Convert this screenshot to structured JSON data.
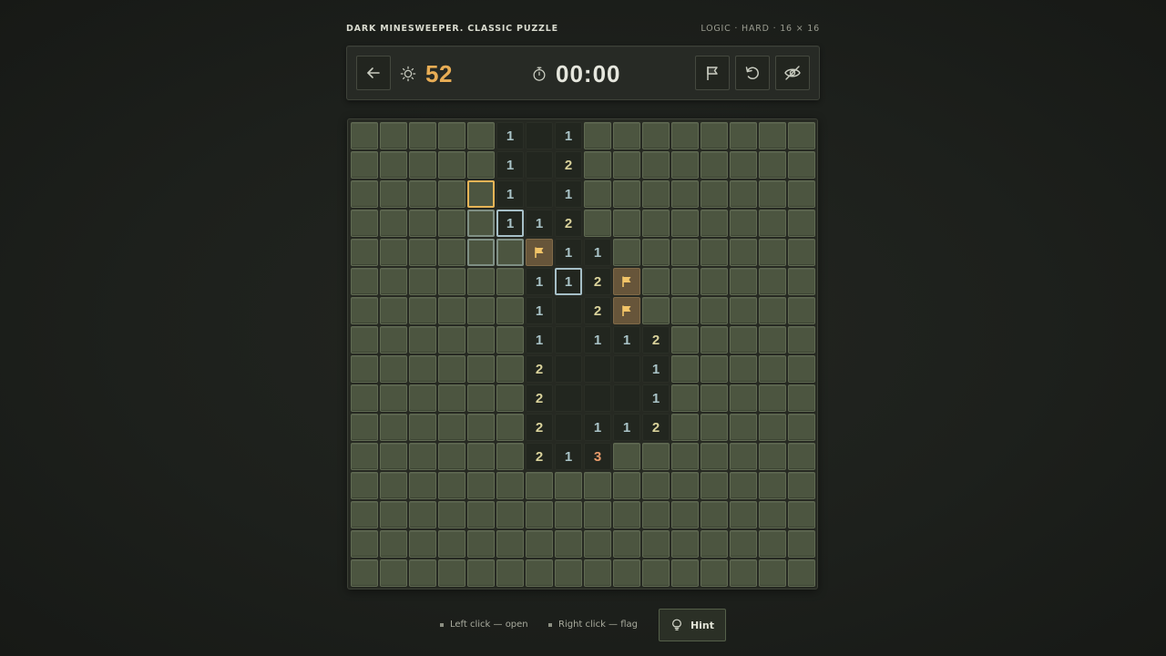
{
  "header": {
    "title": "DARK MINESWEEPER. CLASSIC PUZZLE",
    "meta": "LOGIC · HARD · 16 × 16"
  },
  "toolbar": {
    "back_icon": "arrow-left-icon",
    "mine_counter": {
      "icon": "sun-icon",
      "value": "52"
    },
    "timer": {
      "icon": "stopwatch-icon",
      "value": "00:00"
    },
    "actions": [
      {
        "name": "flag-mode-button",
        "icon": "flag-icon"
      },
      {
        "name": "restart-button",
        "icon": "restart-icon"
      },
      {
        "name": "toggle-visibility-button",
        "icon": "eye-slash-icon"
      }
    ]
  },
  "colors": {
    "accent": "#e8ad55",
    "number_1": "#a9c3c7",
    "number_2": "#d9d29b",
    "number_3": "#e89b6b",
    "hidden_cell": "#4c5540",
    "flag_cell": "#67553a"
  },
  "board": {
    "size": 16,
    "legend": "H = hidden, O = opened empty, F = flagged, digits = opened numbers",
    "rows": [
      "HHHHH1O1HHHHHHHH",
      "HHHHH1O2HHHHHHHH",
      "HHHHH1O1HHHHHHHH",
      "HHHHH112HHHHHHHH",
      "HHHHHHF11HHHHHHH",
      "HHHHHH112FHHHHHH",
      "HHHHHH1O2FHHHHHH",
      "HHHHHH1O112HHHHH",
      "HHHHHH2OOO1HHHHH",
      "HHHHHH2OOO1HHHHH",
      "HHHHHH2O112HHHHH",
      "HHHHHH213HHHHHHH",
      "HHHHHHHHHHHHHHHH",
      "HHHHHHHHHHHHHHHH",
      "HHHHHHHHHHHHHHHH",
      "HHHHHHHHHHHHHHHH"
    ],
    "selected_gold": [
      [
        2,
        4
      ]
    ],
    "selected_blue": [
      [
        3,
        5
      ],
      [
        5,
        7
      ]
    ],
    "selected_soft": [
      [
        3,
        4
      ],
      [
        4,
        4
      ],
      [
        4,
        5
      ]
    ]
  },
  "footer": {
    "left_click": "Left click — open",
    "right_click": "Right click — flag",
    "hint_label": "Hint",
    "hint_icon": "lightbulb-icon"
  }
}
